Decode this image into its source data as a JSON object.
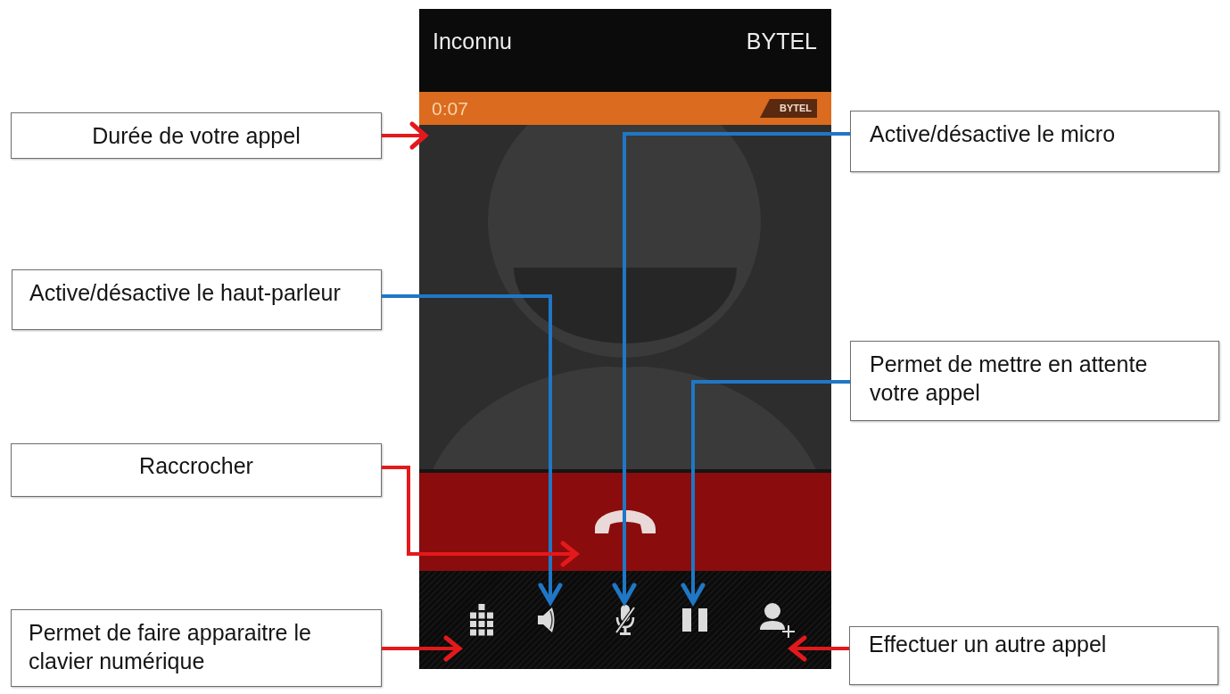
{
  "phone": {
    "caller": "Inconnu",
    "carrier": "BYTEL",
    "call_timer": "0:07",
    "carrier_badge": "BYTEL",
    "controls": [
      {
        "kind": "dialpad"
      },
      {
        "kind": "speaker"
      },
      {
        "kind": "mute"
      },
      {
        "kind": "hold"
      },
      {
        "kind": "add_call"
      }
    ]
  },
  "callouts": [
    {
      "text": "Durée de votre appel",
      "color": "#e3191c"
    },
    {
      "text": "Active/désactive le micro",
      "color": "#1f77c6"
    },
    {
      "text": "Active/désactive le haut-parleur",
      "color": "#1f77c6"
    },
    {
      "text": "Permet de mettre en attente votre appel",
      "color": "#1f77c6"
    },
    {
      "text": "Raccrocher",
      "color": "#e3191c"
    },
    {
      "text": "Permet de faire apparaitre le clavier numérique",
      "color": "#e3191c"
    },
    {
      "text": "Effectuer un autre appel",
      "color": "#e3191c"
    }
  ]
}
